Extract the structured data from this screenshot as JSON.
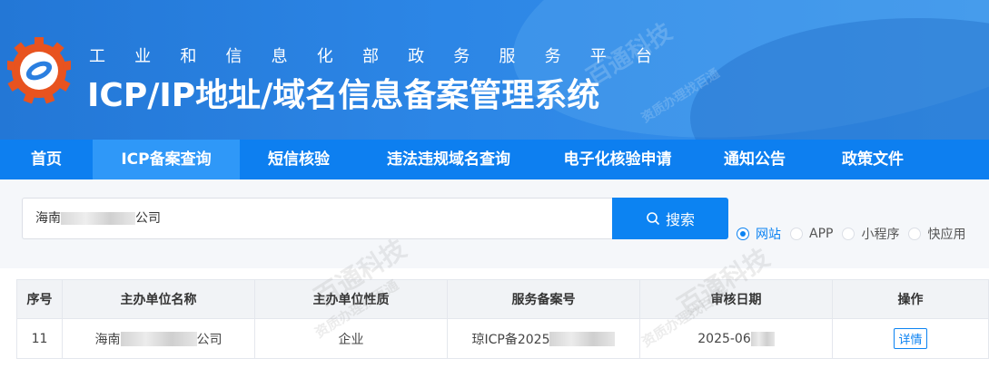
{
  "header": {
    "sub_title_chars": [
      "工",
      "业",
      "和",
      "信",
      "息",
      "化",
      "部",
      "政",
      "务",
      "服",
      "务",
      "平",
      "台"
    ],
    "main_title": "ICP/IP地址/域名信息备案管理系统"
  },
  "nav": {
    "items": [
      {
        "label": "首页",
        "active": false
      },
      {
        "label": "ICP备案查询",
        "active": true
      },
      {
        "label": "短信核验",
        "active": false
      },
      {
        "label": "违法违规域名查询",
        "active": false
      },
      {
        "label": "电子化核验申请",
        "active": false
      },
      {
        "label": "通知公告",
        "active": false
      },
      {
        "label": "政策文件",
        "active": false
      }
    ]
  },
  "search": {
    "value_prefix": "海南",
    "value_suffix": "公司",
    "button_label": "搜索",
    "types": [
      {
        "label": "网站",
        "checked": true
      },
      {
        "label": "APP",
        "checked": false
      },
      {
        "label": "小程序",
        "checked": false
      },
      {
        "label": "快应用",
        "checked": false
      }
    ]
  },
  "table": {
    "headers": [
      "序号",
      "主办单位名称",
      "主办单位性质",
      "服务备案号",
      "审核日期",
      "操作"
    ],
    "rows": [
      {
        "index": "11",
        "name_prefix": "海南",
        "name_suffix": "公司",
        "nature": "企业",
        "record_no": "琼ICP备2025",
        "date": "2025-06",
        "action": "详情"
      }
    ]
  },
  "watermark": {
    "title": "百通科技",
    "subtitle": "资质办理找百通"
  },
  "colors": {
    "header_blue": "#2377d6",
    "nav_blue": "#0d7ff0",
    "nav_active": "#2f98f8",
    "button_blue": "#0c83f2"
  }
}
